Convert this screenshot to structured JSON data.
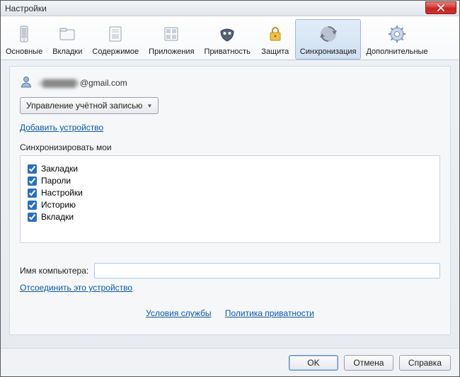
{
  "window": {
    "title": "Настройки"
  },
  "toolbar": {
    "items": [
      {
        "label": "Основные"
      },
      {
        "label": "Вкладки"
      },
      {
        "label": "Содержимое"
      },
      {
        "label": "Приложения"
      },
      {
        "label": "Приватность"
      },
      {
        "label": "Защита"
      },
      {
        "label": "Синхронизация"
      },
      {
        "label": "Дополнительные"
      }
    ]
  },
  "account": {
    "email_prefix_obscured": "a▇▇▇▇▇k",
    "email_suffix": "@gmail.com",
    "manage_label": "Управление учётной записью",
    "add_device_link": "Добавить устройство"
  },
  "sync": {
    "section_label": "Синхронизировать мои",
    "items": [
      {
        "label": "Закладки"
      },
      {
        "label": "Пароли"
      },
      {
        "label": "Настройки"
      },
      {
        "label": "Историю"
      },
      {
        "label": "Вкладки"
      }
    ]
  },
  "computer": {
    "label": "Имя компьютера:",
    "value": "",
    "disconnect_link": "Отсоединить это устройство"
  },
  "policies": {
    "terms": "Условия службы",
    "privacy": "Политика приватности"
  },
  "footer": {
    "ok": "OK",
    "cancel": "Отмена",
    "help": "Справка"
  }
}
